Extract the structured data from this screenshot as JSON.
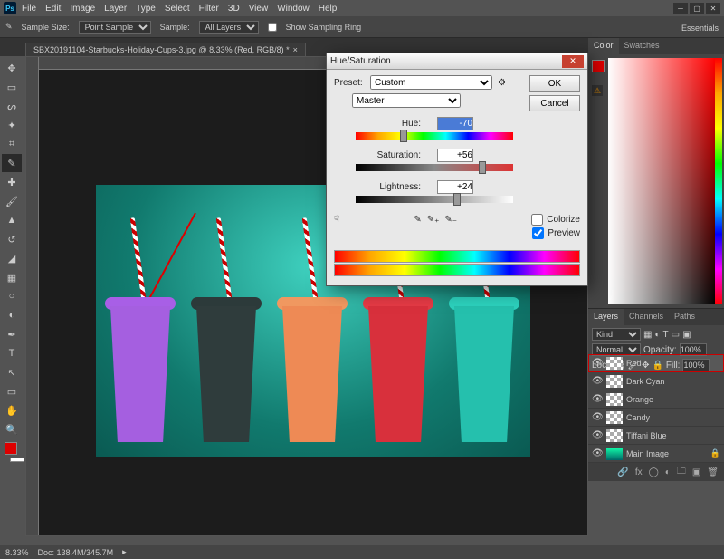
{
  "menu": [
    "File",
    "Edit",
    "Image",
    "Layer",
    "Type",
    "Select",
    "Filter",
    "3D",
    "View",
    "Window",
    "Help"
  ],
  "workspace": "Essentials",
  "optionsBar": {
    "sampleSizeLabel": "Sample Size:",
    "sampleSizeValue": "Point Sample",
    "sampleLabel": "Sample:",
    "sampleValue": "All Layers",
    "showRingLabel": "Show Sampling Ring"
  },
  "documentTab": "SBX20191104-Starbucks-Holiday-Cups-3.jpg @ 8.33% (Red, RGB/8) *",
  "dialog": {
    "title": "Hue/Saturation",
    "presetLabel": "Preset:",
    "presetValue": "Custom",
    "rangeValue": "Master",
    "hueLabel": "Hue:",
    "hueValue": "-70",
    "satLabel": "Saturation:",
    "satValue": "+56",
    "lightLabel": "Lightness:",
    "lightValue": "+24",
    "colorize": "Colorize",
    "preview": "Preview",
    "ok": "OK",
    "cancel": "Cancel"
  },
  "colorPanel": {
    "tabs": [
      "Color",
      "Swatches"
    ]
  },
  "layersPanel": {
    "tabs": [
      "Layers",
      "Channels",
      "Paths"
    ],
    "kindLabel": "Kind",
    "modeValue": "Normal",
    "opacityLabel": "Opacity:",
    "opacityValue": "100%",
    "lockLabel": "Lock:",
    "fillLabel": "Fill:",
    "fillValue": "100%",
    "layers": [
      {
        "name": "Red",
        "locked": false,
        "selected": true
      },
      {
        "name": "Dark Cyan",
        "locked": false
      },
      {
        "name": "Orange",
        "locked": false
      },
      {
        "name": "Candy",
        "locked": false
      },
      {
        "name": "Tiffani Blue",
        "locked": false
      },
      {
        "name": "Main Image",
        "locked": true,
        "img": true
      }
    ]
  },
  "status": {
    "zoom": "8.33%",
    "docinfo": "Doc: 138.4M/345.7M"
  },
  "cups": [
    {
      "lid": "#a85fe6",
      "body": "#a55fe0"
    },
    {
      "lid": "#2c3a3a",
      "body": "#2f3c3c"
    },
    {
      "lid": "#f09860",
      "body": "#ee8a55"
    },
    {
      "lid": "#e43a45",
      "body": "#d8303c"
    },
    {
      "lid": "#2cd0bc",
      "body": "#25c0ad"
    }
  ]
}
